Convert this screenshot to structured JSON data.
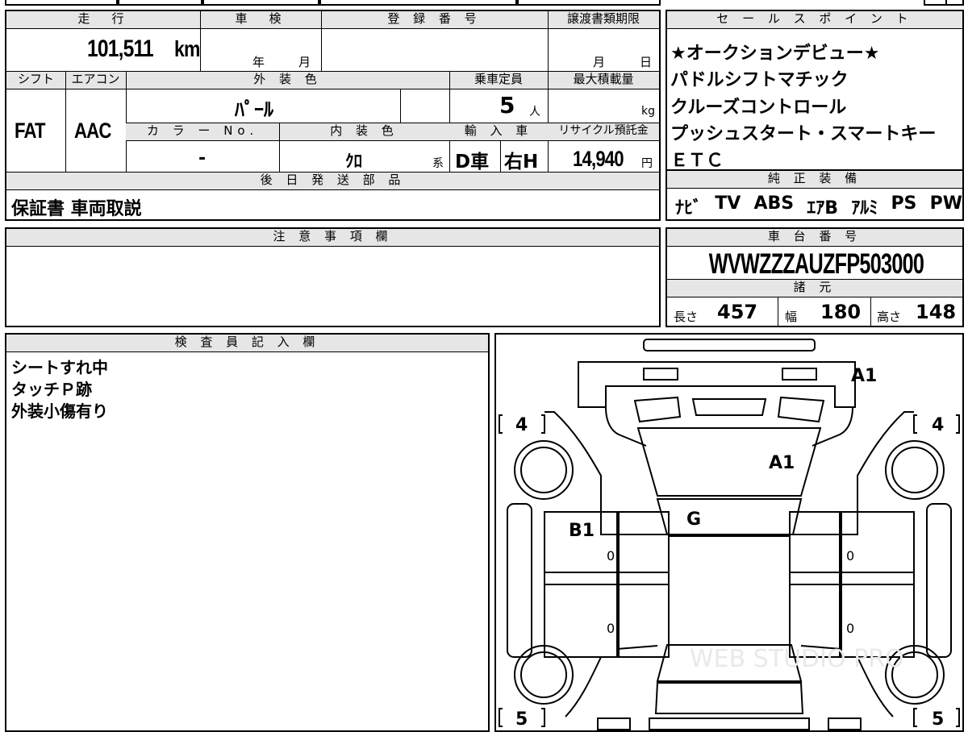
{
  "vehicle_info": {
    "mileage_header": "走　行",
    "mileage_value": "101,511",
    "mileage_unit": "km",
    "inspection_header": "車　検",
    "inspection_year_label": "年",
    "inspection_month_label": "月",
    "registration_header": "登 録 番 号",
    "transfer_deadline_header": "譲渡書類期限",
    "transfer_month_label": "月",
    "transfer_day_label": "日",
    "shift_header": "シフト",
    "shift_value": "FAT",
    "aircon_header": "エアコン",
    "aircon_value": "AAC",
    "exterior_color_header": "外 装 色",
    "exterior_color_value": "ﾊﾟｰﾙ",
    "capacity_header": "乗車定員",
    "capacity_value": "5",
    "capacity_unit": "人",
    "max_load_header": "最大積載量",
    "max_load_unit": "kg",
    "color_no_header": "カ ラ ー No.",
    "color_no_value": "-",
    "interior_color_header": "内 装 色",
    "interior_color_value": "ｸﾛ",
    "interior_color_suffix": "系",
    "import_header": "輸 入 車",
    "import_value": "D車",
    "steering_value": "右H",
    "recycle_header": "リサイクル預託金",
    "recycle_value": "14,940",
    "recycle_unit": "円",
    "later_parts_header": "後 日 発 送 部 品",
    "later_parts_value": "保証書 車両取説"
  },
  "sales_points": {
    "header": "セ ー ル ス ポ イ ン ト",
    "items": [
      "★オークションデビュー★",
      "パドルシフトマチック",
      "クルーズコントロール",
      "プッシュスタート・スマートキー",
      "ＥＴＣ"
    ]
  },
  "equipment": {
    "header": "純 正 装 備",
    "items": [
      "ﾅﾋﾞ",
      "TV",
      "ABS",
      "ｴｱB",
      "ｱﾙﾐ",
      "PS",
      "PW"
    ]
  },
  "notes": {
    "header": "注 意 事 項 欄",
    "text": ""
  },
  "chassis": {
    "header": "車 台 番 号",
    "value": "WVWZZZAUZFP503000",
    "specs_header": "諸 元",
    "length_label": "長さ",
    "length_value": "457",
    "width_label": "幅",
    "width_value": "180",
    "height_label": "高さ",
    "height_value": "148"
  },
  "inspector": {
    "header": "検 査 員 記 入 欄",
    "lines": [
      "シートすれ中",
      "タッチＰ跡",
      "外装小傷有り"
    ]
  },
  "diagram": {
    "tire_front_left": "4",
    "tire_front_right": "4",
    "tire_rear_left": "5",
    "tire_rear_right": "5",
    "mark_front_bumper": "A1",
    "mark_hood": "A1",
    "mark_windshield": "G",
    "mark_left_front_door": "B1",
    "door_zero_1": "0",
    "door_zero_2": "0",
    "door_zero_3": "0",
    "door_zero_4": "0",
    "watermark": "WEB STUDIO PRO"
  }
}
